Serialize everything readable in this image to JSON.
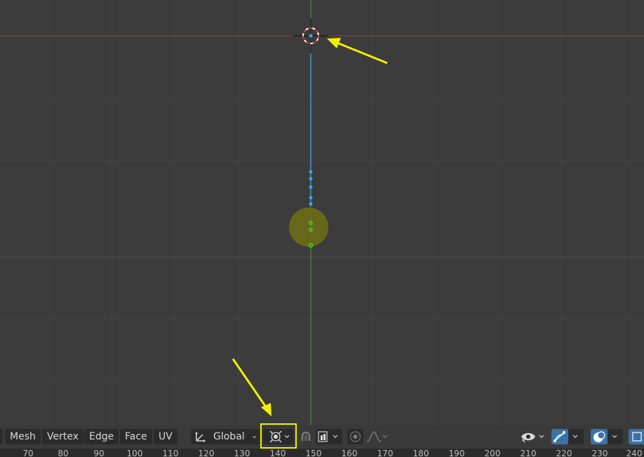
{
  "menu": {
    "mesh": "Mesh",
    "vertex": "Vertex",
    "edge": "Edge",
    "face": "Face",
    "uv": "UV"
  },
  "transform_orientation": {
    "label": "Global"
  },
  "timeline": {
    "ticks": [
      "70",
      "80",
      "90",
      "100",
      "110",
      "120",
      "130",
      "140",
      "150",
      "160",
      "170",
      "180",
      "190",
      "200",
      "210",
      "220",
      "230",
      "240"
    ]
  },
  "icons": {
    "transform_orientation": "axes-icon",
    "snap": "snap-icon",
    "pivot": "pivot-icon",
    "proportional": "proportional-edit-icon",
    "falloff": "falloff-curve-icon",
    "visibility": "eye-icon",
    "gizmo": "gizmo-icon",
    "overlay": "overlay-icon"
  },
  "colors": {
    "viewport_bg": "#3c3c3c",
    "grid": "#444444",
    "x_axis": "#a03a3a",
    "y_axis": "#4c8a30",
    "selected_vertex": "#3aa8e8",
    "green_vertex": "#3adc3a",
    "annotation": "#f0f000",
    "highlight_active": "#3a72a8"
  }
}
